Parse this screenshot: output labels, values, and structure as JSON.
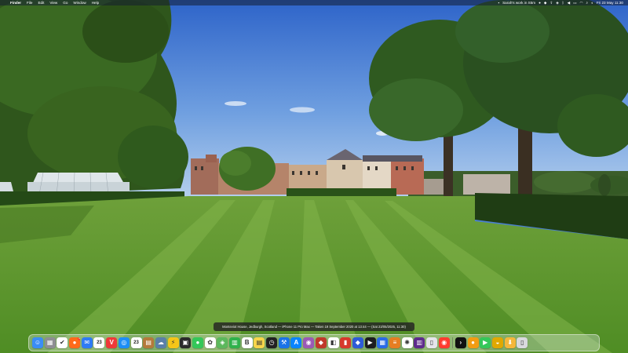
{
  "menubar": {
    "apple_icon": "apple-icon",
    "app_name": "Finder",
    "menus": [
      "File",
      "Edit",
      "View",
      "Go",
      "Window",
      "Help"
    ],
    "status_title": "Sarah's work in S5m",
    "clock": "Fri 23 May 11:30"
  },
  "caption": {
    "text": "Monteviot House, Jedburgh, Scotland — iPhone 11 Pro Max — Taken 19 September 2020 at 13:44 — (Sat 23/05/2025, 11:30)"
  },
  "dock": {
    "calendar_day": "23",
    "mail_badge": "1",
    "items": [
      {
        "name": "finder-icon",
        "color": "#3b8df5",
        "glyph": "☺"
      },
      {
        "name": "launchpad-icon",
        "color": "#8e8e93",
        "glyph": "▦"
      },
      {
        "name": "reminders-icon",
        "color": "#ffffff",
        "glyph": "✔"
      },
      {
        "name": "firefox-icon",
        "color": "#ff6a1a",
        "glyph": "●"
      },
      {
        "name": "mail-icon",
        "color": "#2f7bf5",
        "glyph": "✉"
      },
      {
        "name": "calendar-icon",
        "color": "#ffffff",
        "glyph": "23"
      },
      {
        "name": "vivaldi-icon",
        "color": "#ef3939",
        "glyph": "V"
      },
      {
        "name": "safari-icon",
        "color": "#1d8ef7",
        "glyph": "◎"
      },
      {
        "name": "calendar-icon",
        "color": "#ffffff",
        "glyph": "23"
      },
      {
        "name": "archive-icon",
        "color": "#b5793b",
        "glyph": "▤"
      },
      {
        "name": "weather-icon",
        "color": "#5a7fa8",
        "glyph": "☁"
      },
      {
        "name": "lightning-icon",
        "color": "#f5c518",
        "glyph": "⚡"
      },
      {
        "name": "terminal-icon",
        "color": "#2b2b2b",
        "glyph": "▣"
      },
      {
        "name": "messages-icon",
        "color": "#34c759",
        "glyph": "●"
      },
      {
        "name": "photos-icon",
        "color": "#ffffff",
        "glyph": "✿"
      },
      {
        "name": "maps-icon",
        "color": "#5cb85c",
        "glyph": "◈"
      },
      {
        "name": "numbers-icon",
        "color": "#2fb24c",
        "glyph": "▥"
      },
      {
        "name": "bbedit-icon",
        "color": "#ffffff",
        "glyph": "B"
      },
      {
        "name": "notes-icon",
        "color": "#f7d54a",
        "glyph": "▤"
      },
      {
        "name": "clock-icon",
        "color": "#222222",
        "glyph": "◷"
      },
      {
        "name": "xcode-icon",
        "color": "#1a73e8",
        "glyph": "⚒"
      },
      {
        "name": "appstore-icon",
        "color": "#0a84ff",
        "glyph": "A"
      },
      {
        "name": "podcasts-icon",
        "color": "#9b59b6",
        "glyph": "◉"
      },
      {
        "name": "affinity-icon",
        "color": "#c0392b",
        "glyph": "◆"
      },
      {
        "name": "frame-icon",
        "color": "#ffffff",
        "glyph": "◧"
      },
      {
        "name": "bear-icon",
        "color": "#d7382c",
        "glyph": "▮"
      },
      {
        "name": "shield-icon",
        "color": "#2e5bd8",
        "glyph": "◆"
      },
      {
        "name": "tv-icon",
        "color": "#1c1c1e",
        "glyph": "▶"
      },
      {
        "name": "gpu-icon",
        "color": "#2a6be8",
        "glyph": "▦"
      },
      {
        "name": "stack-icon",
        "color": "#e67e22",
        "glyph": "≡"
      },
      {
        "name": "openai-icon",
        "color": "#ffffff",
        "glyph": "✺"
      },
      {
        "name": "equalizer-icon",
        "color": "#5e2b8c",
        "glyph": "▥"
      },
      {
        "name": "document-icon",
        "color": "#e5e5ea",
        "glyph": "▯"
      },
      {
        "name": "record-icon",
        "color": "#ff3b30",
        "glyph": "◉"
      },
      {
        "name": "terminal-icon",
        "color": "#111111",
        "glyph": "›"
      },
      {
        "name": "orange-app-icon",
        "color": "#f39c12",
        "glyph": "●"
      },
      {
        "name": "facetime-icon",
        "color": "#34c759",
        "glyph": "▶"
      },
      {
        "name": "gold-app-icon",
        "color": "#e0a800",
        "glyph": "◒"
      },
      {
        "name": "downloads-icon",
        "color": "#f5b73b",
        "glyph": "⬇"
      },
      {
        "name": "trash-icon",
        "color": "#d9d9de",
        "glyph": "▯"
      }
    ]
  }
}
